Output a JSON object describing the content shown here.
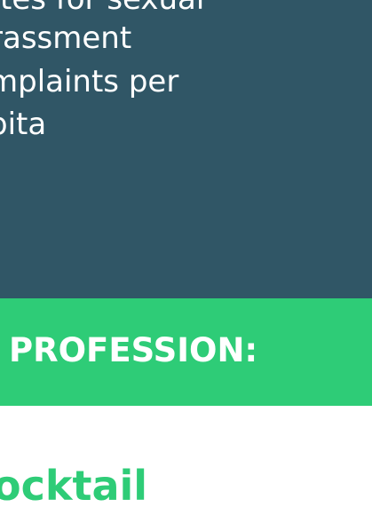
{
  "colors": {
    "top_panel": "#305666",
    "green_band": "#2ecc77",
    "white_text": "#ffffff",
    "green_text": "#2ecc77"
  },
  "top_panel": {
    "lines": [
      "tes for sexual",
      "rassment",
      "mplaints per",
      "pita"
    ]
  },
  "green_band": {
    "label": "PROFESSION:"
  },
  "bottom": {
    "text": "ocktail"
  }
}
